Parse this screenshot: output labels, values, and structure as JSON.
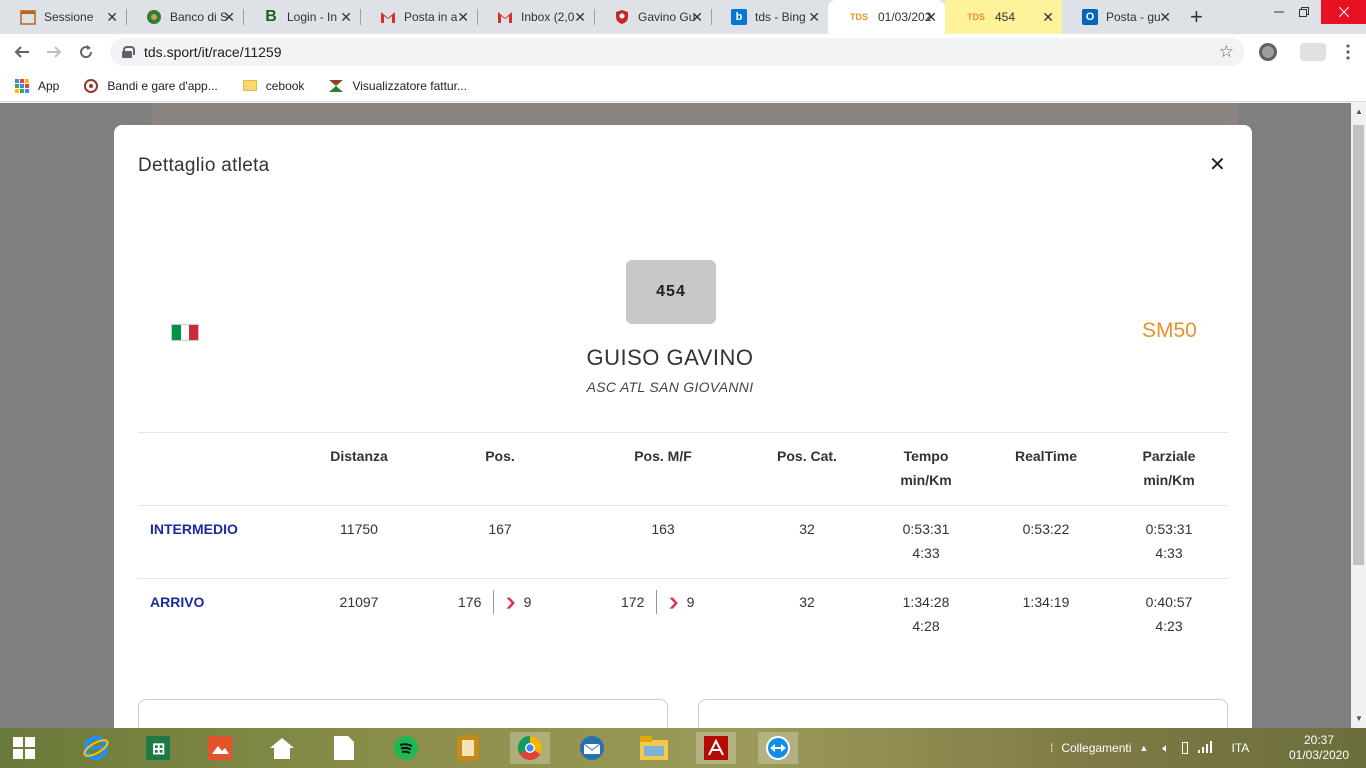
{
  "browser": {
    "tabs": [
      {
        "title": "Sessione",
        "icon": "calendar-icon",
        "state": "normal"
      },
      {
        "title": "Banco di S",
        "icon": "bank-icon",
        "state": "normal"
      },
      {
        "title": "Login - In",
        "icon": "b-logo-icon",
        "state": "normal"
      },
      {
        "title": "Posta in a",
        "icon": "gmail-icon",
        "state": "normal"
      },
      {
        "title": "Inbox (2,0",
        "icon": "gmail-icon",
        "state": "normal"
      },
      {
        "title": "Gavino Gu",
        "icon": "shield-icon",
        "state": "normal"
      },
      {
        "title": "tds - Bing",
        "icon": "bing-icon",
        "state": "normal"
      },
      {
        "title": "01/03/202",
        "icon": "tds-icon",
        "state": "active"
      },
      {
        "title": "454",
        "icon": "tds-icon",
        "state": "highlighted"
      },
      {
        "title": "Posta - gu",
        "icon": "outlook-icon",
        "state": "normal"
      }
    ],
    "tab_close_glyph": "✕",
    "new_tab_glyph": "+",
    "url": "tds.sport/it/race/11259",
    "bookmarks": [
      {
        "label": "App",
        "icon": "apps-grid-icon"
      },
      {
        "label": "Bandi e gare d'app...",
        "icon": "bandi-icon"
      },
      {
        "label": "cebook",
        "icon": "folder-icon"
      },
      {
        "label": "Visualizzatore fattur...",
        "icon": "invoice-icon"
      }
    ]
  },
  "modal": {
    "title": "Dettaglio atleta",
    "close_glyph": "✕"
  },
  "athlete": {
    "bib": "454",
    "name": "GUISO GAVINO",
    "club": "ASC ATL SAN GIOVANNI",
    "category": "SM50",
    "flag": "italy-flag-icon"
  },
  "table": {
    "headers": {
      "distance": "Distanza",
      "pos": "Pos.",
      "pos_mf": "Pos. M/F",
      "pos_cat": "Pos. Cat.",
      "time_line1": "Tempo",
      "time_line2": "min/Km",
      "realtime": "RealTime",
      "split_line1": "Parziale",
      "split_line2": "min/Km"
    },
    "rows": [
      {
        "label": "INTERMEDIO",
        "distance": "11750",
        "pos": "167",
        "pos_mf": "163",
        "pos_cat": "32",
        "time": "0:53:31",
        "time_pace": "4:33",
        "realtime": "0:53:22",
        "split": "0:53:31",
        "split_pace": "4:33"
      },
      {
        "label": "ARRIVO",
        "distance": "21097",
        "pos": "176",
        "pos_delta": "9",
        "pos_mf": "172",
        "pos_mf_delta": "9",
        "pos_cat": "32",
        "time": "1:34:28",
        "time_pace": "4:28",
        "realtime": "1:34:19",
        "split": "0:40:57",
        "split_pace": "4:23"
      }
    ]
  },
  "taskbar": {
    "tray_label": "Collegamenti",
    "language": "ITA",
    "time": "20:37",
    "date": "01/03/2020"
  },
  "colors": {
    "accent_orange": "#e8932a",
    "row_label_blue": "#1c2aa0",
    "delta_down_red": "#e0304c",
    "bib_grey": "#c8c8c8"
  }
}
